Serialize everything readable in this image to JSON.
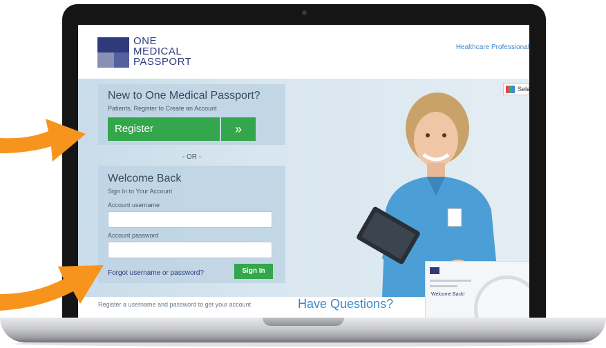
{
  "header": {
    "logo_line1": "ONE",
    "logo_line2": "MEDICAL",
    "logo_line3": "PASSPORT",
    "link_text": "Healthcare Professional"
  },
  "register_panel": {
    "title": "New to One Medical Passport?",
    "subtitle": "Patients, Register to Create an Account",
    "button_label": "Register",
    "button_icon": "»"
  },
  "or_text": "- OR -",
  "signin_panel": {
    "title": "Welcome Back",
    "subtitle": "Sign In to Your Account",
    "username_label": "Account username",
    "username_value": "",
    "password_label": "Account password",
    "password_value": "",
    "forgot_link": "Forgot username or password?",
    "signin_label": "Sign In"
  },
  "language_button": "Selec",
  "thumbnail": {
    "welcome": "Welcome Back!"
  },
  "footer": {
    "left_text": "Register a username and password to get your account",
    "right_text": "Have Questions?"
  },
  "colors": {
    "brand_blue": "#2e3a7c",
    "accent_green": "#34a64b",
    "arrow_orange": "#f7941d",
    "link_blue": "#3e88c8"
  }
}
